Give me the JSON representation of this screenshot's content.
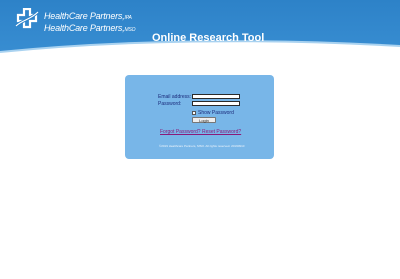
{
  "header": {
    "brand_line1": "HealthCare Partners,",
    "brand_line1_suffix": "IPA",
    "brand_line2": "HealthCare Partners,",
    "brand_line2_suffix": "MSO",
    "app_title": "Online Research Tool"
  },
  "login": {
    "email_label": "Email address:",
    "password_label": "Password:",
    "show_password_label": "Show Password",
    "login_button": "Login",
    "forgot_link": "Forgot Password? Reset Password?",
    "copyright": "©2019 Healthcare Partners, MSO. All rights reserved. 20190910"
  },
  "colors": {
    "header_blue": "#2d82c8",
    "panel_blue": "#78b6e8",
    "link_purple": "#8a1a7a"
  }
}
